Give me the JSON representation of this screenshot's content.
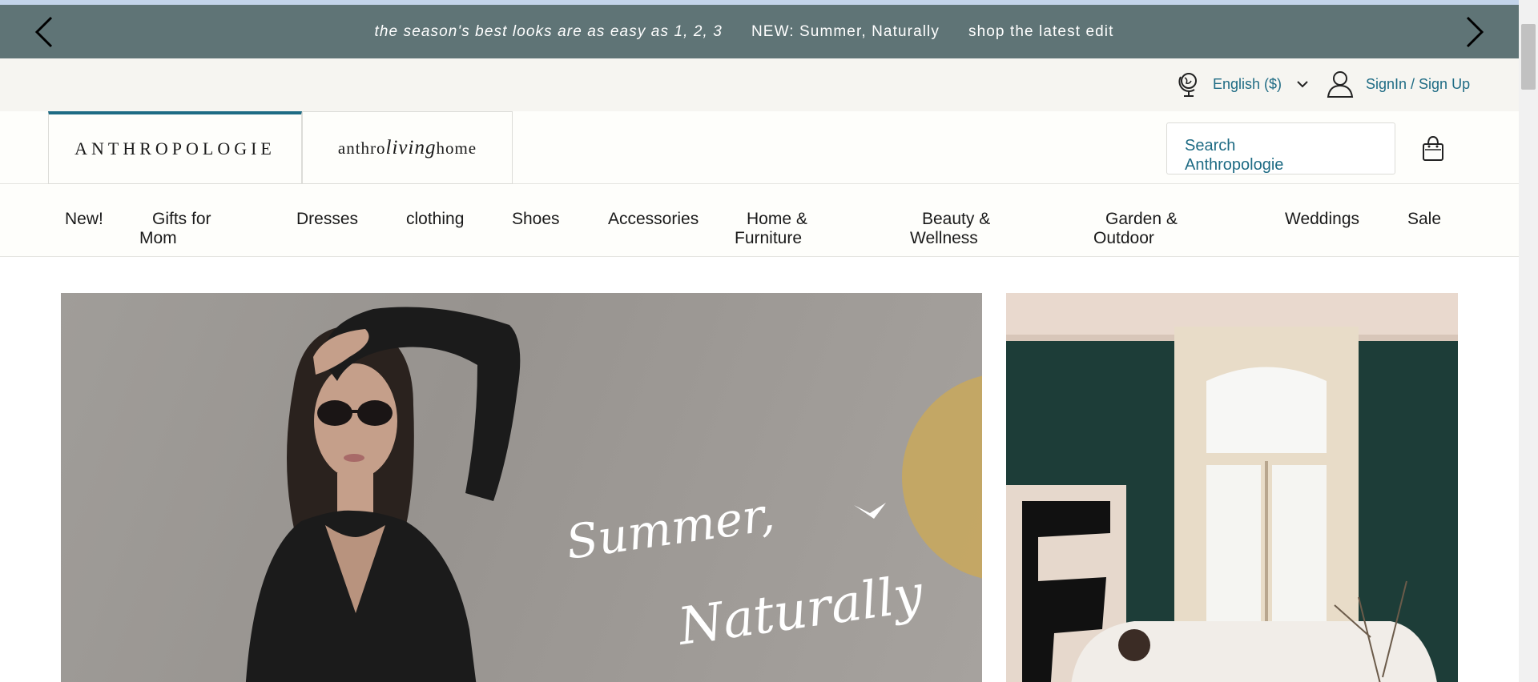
{
  "promo": {
    "messages": [
      "the season's best looks are as easy as 1, 2, 3",
      "NEW: Summer, Naturally",
      "shop the latest edit"
    ],
    "prev_icon": "chevron-left-icon",
    "next_icon": "chevron-right-icon"
  },
  "utility": {
    "language_label": "English ($)",
    "signin_label": "SignIn / Sign Up",
    "icons": [
      "globe-icon",
      "chevron-down-icon",
      "user-icon"
    ]
  },
  "header": {
    "brand_anthropologie": "ANTHROPOLOGIE",
    "brand_living_left": "anthro",
    "brand_living_script": "living",
    "brand_living_right": "home",
    "search_placeholder": "Search Anthropologie",
    "bag_icon": "shopping-bag-icon"
  },
  "nav": {
    "items": [
      "New!",
      "Gifts for Mom",
      "Dresses",
      "clothing",
      "Shoes",
      "Accessories",
      "Home & Furniture",
      "Beauty & Wellness",
      "Garden & Outdoor",
      "Weddings",
      "Sale"
    ]
  },
  "hero": {
    "left_script": [
      "Summer,",
      "Naturally"
    ]
  },
  "colors": {
    "promo_bar": "#5f7476",
    "accent": "#1e6b84",
    "utility_bg": "#f6f5f1",
    "header_bg": "#fefefb"
  }
}
